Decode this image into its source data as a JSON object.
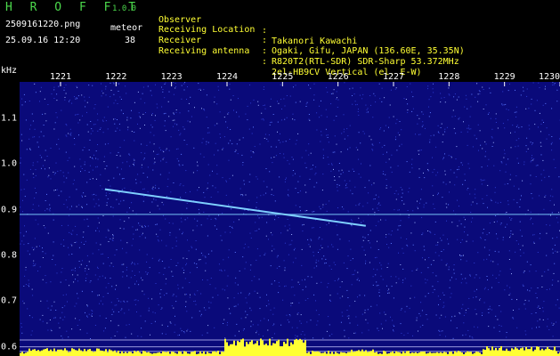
{
  "header": {
    "brand": "H R O F F T",
    "version": "1.0.0",
    "filename": "2509161220.png",
    "datetime": "25.09.16 12:20",
    "meteor_label": "meteor",
    "meteor_count": "38"
  },
  "station_info": [
    {
      "key": "Observer",
      "value": "Takanori Kawachi"
    },
    {
      "key": "Receiving Location",
      "value": "Ogaki, Gifu, JAPAN (136.60E, 35.35N)"
    },
    {
      "key": "Receiver",
      "value": "R820T2(RTL-SDR) SDR-Sharp 53.372MHz"
    },
    {
      "key": "Receiving antenna",
      "value": "2el-HB9CV Vertical (el. E-W)"
    }
  ],
  "separator": ":",
  "colors": {
    "background": "#000000",
    "spectrogram_bg": "#0a0a7a",
    "header_green": "#4cd94c",
    "info_yellow": "#ffff33",
    "trace": "#7fd0ff",
    "bottom_signal": "#ffff33"
  },
  "chart_data": {
    "type": "heatmap",
    "x_unit": "",
    "y_unit": "kHz",
    "x_ticks": [
      "1221",
      "1222",
      "1223",
      "1224",
      "1225",
      "1226",
      "1227",
      "1228",
      "1229",
      "1230"
    ],
    "y_ticks": [
      "1.1",
      "1.0",
      "0.9",
      "0.8",
      "0.7",
      "0.6"
    ],
    "ylim": [
      0.58,
      1.18
    ],
    "carrier_khz": 0.89,
    "meteor_trace": {
      "start": {
        "x": 1221.8,
        "y": 0.945
      },
      "end": {
        "x": 1226.5,
        "y": 0.865
      }
    }
  }
}
